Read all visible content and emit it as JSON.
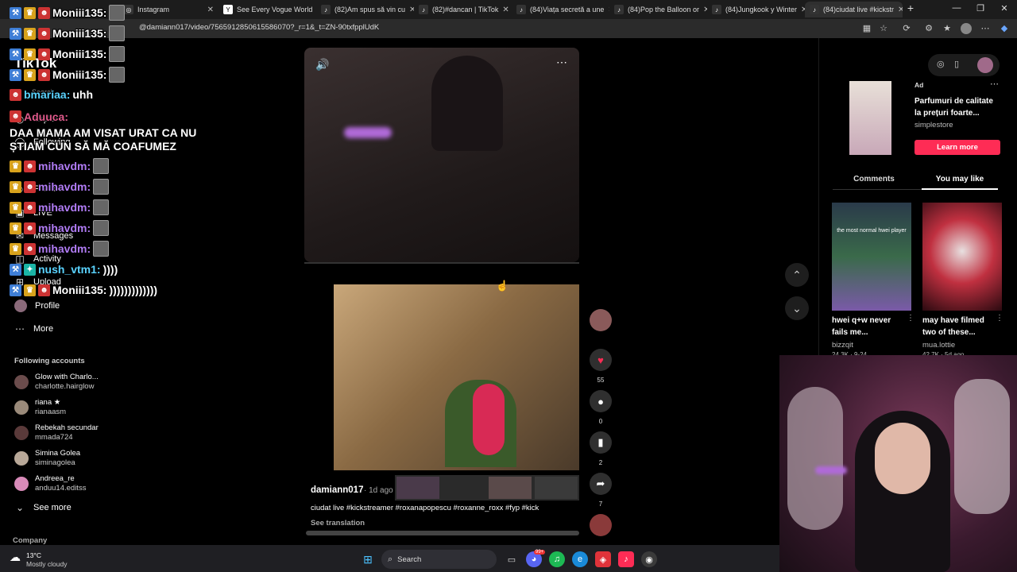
{
  "browser": {
    "tabs": [
      {
        "label": "Instagram",
        "icon": "instagram-icon"
      },
      {
        "label": "See Every Vogue World",
        "icon": "vogue-icon"
      },
      {
        "label": "(82)Am spus să vin cu",
        "icon": "tiktok-icon"
      },
      {
        "label": "(82)#dancan | TikTok",
        "icon": "tiktok-icon"
      },
      {
        "label": "(84)Viața secretă a une",
        "icon": "tiktok-icon"
      },
      {
        "label": "(84)Pop the Balloon or",
        "icon": "tiktok-icon"
      },
      {
        "label": "(84)Jungkook y Winter",
        "icon": "tiktok-icon"
      },
      {
        "label": "(84)ciudat live #kickstr",
        "icon": "tiktok-icon"
      }
    ],
    "new_tab": "+",
    "url": "@damiann017/video/7565912850615586070?_r=1&_t=ZN-90txfpplUdK"
  },
  "sidebar": {
    "logo": "TikTok",
    "search_label": "Search",
    "nav": [
      {
        "label": "Explore",
        "icon": "compass-icon"
      },
      {
        "label": "Following",
        "icon": "following-icon"
      },
      {
        "label": "Friends",
        "icon": "friends-icon"
      },
      {
        "label": "LIVE",
        "icon": "live-icon"
      },
      {
        "label": "Messages",
        "icon": "messages-icon"
      },
      {
        "label": "Activity",
        "icon": "activity-icon"
      },
      {
        "label": "Upload",
        "icon": "upload-icon"
      },
      {
        "label": "Profile",
        "icon": "profile-icon"
      },
      {
        "label": "More",
        "icon": "more-icon"
      }
    ],
    "following_heading": "Following accounts",
    "accounts": [
      {
        "name": "Glow with Charlo...",
        "handle": "charlotte.hairglow"
      },
      {
        "name": "riana ★",
        "handle": "rianaasm"
      },
      {
        "name": "Rebekah secundar",
        "handle": "mmada724"
      },
      {
        "name": "Simina Golea",
        "handle": "siminagolea"
      },
      {
        "name": "Andreea_re",
        "handle": "anduu14.editss"
      }
    ],
    "see_more": "See more",
    "company": "Company"
  },
  "chat": [
    {
      "user": "Moniii135:",
      "msg": "",
      "color": "#f0f0f0"
    },
    {
      "user": "Moniii135:",
      "msg": "",
      "color": "#f0f0f0"
    },
    {
      "user": "Moniii135:",
      "msg": "",
      "color": "#f0f0f0"
    },
    {
      "user": "Moniii135:",
      "msg": "",
      "color": "#f0f0f0"
    },
    {
      "user": "bmariaa:",
      "msg": "uhh",
      "color": "#5ad3ff"
    },
    {
      "user": "Aduuca:",
      "msg": "DAA MAMA AM VISAT URAT CA NU ȘTIAM CUN SĂ MĂ COAFUMEZ",
      "color": "#e05a8b"
    },
    {
      "user": "mihavdm:",
      "msg": "",
      "color": "#b17cf5"
    },
    {
      "user": "mihavdm:",
      "msg": "",
      "color": "#b17cf5"
    },
    {
      "user": "mihavdm:",
      "msg": "",
      "color": "#b17cf5"
    },
    {
      "user": "mihavdm:",
      "msg": "",
      "color": "#b17cf5"
    },
    {
      "user": "mihavdm:",
      "msg": "",
      "color": "#b17cf5"
    },
    {
      "user": "nush_vtm1:",
      "msg": "))))",
      "color": "#5ad3ff"
    },
    {
      "user": "Moniii135:",
      "msg": ")))))))))))))",
      "color": "#f0f0f0"
    }
  ],
  "video": {
    "author": "damiann017",
    "time": "· 1d ago",
    "caption": "ciudat live #kickstreamer #roxanapopescu #roxanne_roxx #fyp #kick",
    "see_translation": "See translation",
    "likes": "55",
    "comments": "0",
    "saves": "2",
    "shares": "7"
  },
  "right_panel": {
    "ad_label": "Ad",
    "ad_title": "Parfumuri de calitate la prețuri foarte...",
    "ad_brand": "simplestore",
    "learn_more": "Learn more",
    "tabs": [
      "Comments",
      "You may like"
    ],
    "cards": [
      {
        "overlay": "the most normal hwei player",
        "title": "hwei q+w never fails me...",
        "user": "bizzqit",
        "stats": "24.3K · 9-24"
      },
      {
        "overlay": "",
        "title": "may have filmed two of these...",
        "user": "mua.lottie",
        "stats": "42.7K · 5d ago"
      }
    ]
  },
  "taskbar": {
    "weather_temp": "13°C",
    "weather_desc": "Mostly cloudy",
    "search": "Search",
    "badge_count": "99+"
  },
  "colors": {
    "accent_red": "#fe2c55",
    "tiktok_bg": "#000000"
  }
}
